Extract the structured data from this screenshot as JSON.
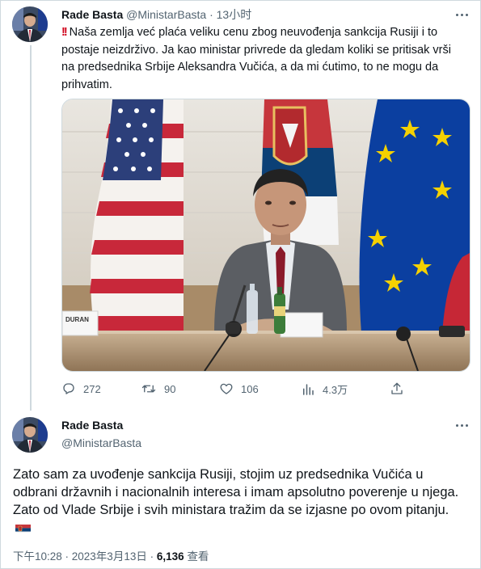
{
  "tweet1": {
    "author_name": "Rade Basta",
    "author_handle": "@MinistarBasta",
    "separator": "·",
    "time": "13小时",
    "alert_emoji": "!!",
    "text": "Naša zemlja već plaća veliku cenu zbog neuvođenja sankcija Rusiji i to postaje neizdrživo. Ja kao ministar privrede da gledam koliki se pritisak vrši na predsednika Srbije Aleksandra Vučića, a da mi ćutimo, to ne mogu da prihvatim.",
    "photo_nameplate": "DURAN",
    "actions": {
      "replies": "272",
      "retweets": "90",
      "likes": "106",
      "views": "4.3万"
    }
  },
  "tweet2": {
    "author_name": "Rade Basta",
    "author_handle": "@MinistarBasta",
    "text": "Zato sam za uvođenje sankcija Rusiji, stojim uz predsednika Vučića u odbrani državnih i nacionalnih interesa i imam apsolutno poverenje u njega. Zato od Vlade Srbije i svih ministara tražim da se izjasne po ovom pitanju.",
    "timestamp": "下午10:28 · 2023年3月13日",
    "separator": "·",
    "views_count": "6,136",
    "views_label": "查看"
  },
  "colors": {
    "text_primary": "#0f1419",
    "text_secondary": "#536471",
    "border": "#cfd9de",
    "alert": "#d0021b"
  },
  "icons": [
    "reply-icon",
    "retweet-icon",
    "like-icon",
    "views-icon",
    "share-icon",
    "more-icon",
    "serbia-flag-emoji",
    "double-exclamation-emoji"
  ]
}
